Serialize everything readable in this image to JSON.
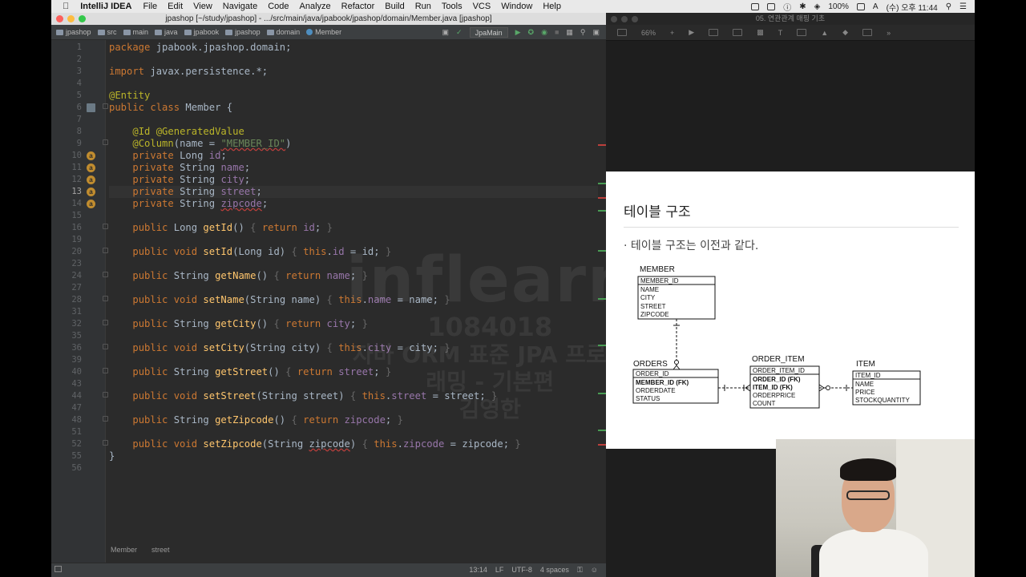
{
  "menubar": {
    "app_name": "IntelliJ IDEA",
    "menus": [
      "File",
      "Edit",
      "View",
      "Navigate",
      "Code",
      "Analyze",
      "Refactor",
      "Build",
      "Run",
      "Tools",
      "VCS",
      "Window",
      "Help"
    ],
    "battery": "100%",
    "clock": "(수) 오후 11:44"
  },
  "ide": {
    "window_title": "jpashop [~/study/jpashop] - .../src/main/java/jpabook/jpashop/domain/Member.java [jpashop]",
    "breadcrumbs": [
      "jpashop",
      "src",
      "main",
      "java",
      "jpabook",
      "jpashop",
      "domain",
      "Member"
    ],
    "run_config": "JpaMain",
    "status_crumbs": [
      "Member",
      "street"
    ],
    "cursor_position": "13:14",
    "line_separator": "LF",
    "encoding": "UTF-8",
    "indent": "4 spaces"
  },
  "code": {
    "line_numbers": [
      "1",
      "2",
      "3",
      "4",
      "5",
      "6",
      "7",
      "8",
      "9",
      "10",
      "11",
      "12",
      "13",
      "14",
      "15",
      "16",
      "19",
      "20",
      "23",
      "24",
      "27",
      "28",
      "31",
      "32",
      "35",
      "36",
      "39",
      "40",
      "43",
      "44",
      "47",
      "48",
      "51",
      "52",
      "55",
      "56"
    ],
    "current_line": "13"
  },
  "watermark": {
    "logo": "inflearn",
    "id": "1084018",
    "course": "자바 ORM 표준 JPA 프로그래밍 - 기본편",
    "name": "김영한"
  },
  "keynote": {
    "window_title": "05. 연관관계 매핑 기초",
    "zoom": "66%"
  },
  "slide": {
    "title": "테이블 구조",
    "bullet": "테이블 구조는 이전과 같다.",
    "tables": {
      "member": {
        "name": "MEMBER",
        "fields": [
          "MEMBER_ID",
          "NAME",
          "CITY",
          "STREET",
          "ZIPCODE"
        ]
      },
      "orders": {
        "name": "ORDERS",
        "fields": [
          "ORDER_ID",
          "MEMBER_ID (FK)",
          "ORDERDATE",
          "STATUS"
        ]
      },
      "order_item": {
        "name": "ORDER_ITEM",
        "fields": [
          "ORDER_ITEM_ID",
          "ORDER_ID (FK)",
          "ITEM_ID (FK)",
          "ORDERPRICE",
          "COUNT"
        ]
      },
      "item": {
        "name": "ITEM",
        "fields": [
          "ITEM_ID",
          "NAME",
          "PRICE",
          "STOCKQUANTITY"
        ]
      }
    }
  }
}
